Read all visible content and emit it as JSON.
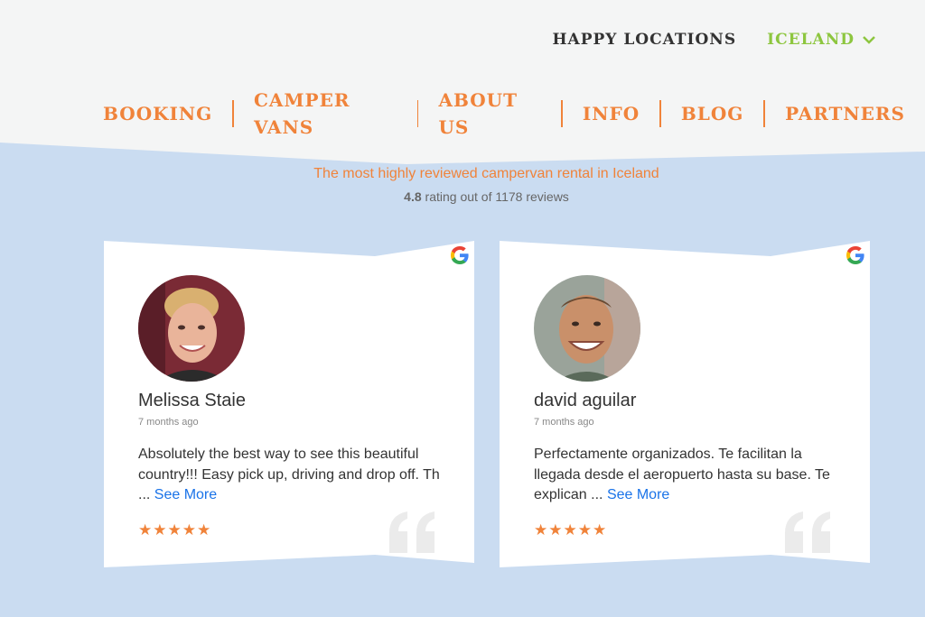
{
  "header": {
    "locations_label": "HAPPY LOCATIONS",
    "country_label": "ICELAND",
    "nav": [
      "BOOKING",
      "CAMPER VANS",
      "ABOUT US",
      "INFO",
      "BLOG",
      "PARTNERS"
    ]
  },
  "reviews_summary": {
    "headline": "The most highly reviewed campervan rental in Iceland",
    "rating_value": "4.8",
    "rating_text": " rating out of 1178 reviews"
  },
  "reviews": [
    {
      "name": "Melissa Staie",
      "time": "7 months ago",
      "text": "Absolutely the best way to see this beautiful country!!! Easy pick up, driving and drop off. Th ... ",
      "more": "See More",
      "stars": "★★★★★",
      "source_icon": "google-icon"
    },
    {
      "name": "david aguilar",
      "time": "7 months ago",
      "text": "Perfectamente organizados. Te facilitan la llegada desde el aeropuerto hasta su base. Te explican ... ",
      "more": "See More",
      "stars": "★★★★★",
      "source_icon": "google-icon"
    }
  ],
  "colors": {
    "accent_orange": "#f0833a",
    "accent_green": "#8dc63f",
    "background_blue": "#cadcf1",
    "header_gray": "#f4f5f5",
    "link_blue": "#1a73e8"
  }
}
